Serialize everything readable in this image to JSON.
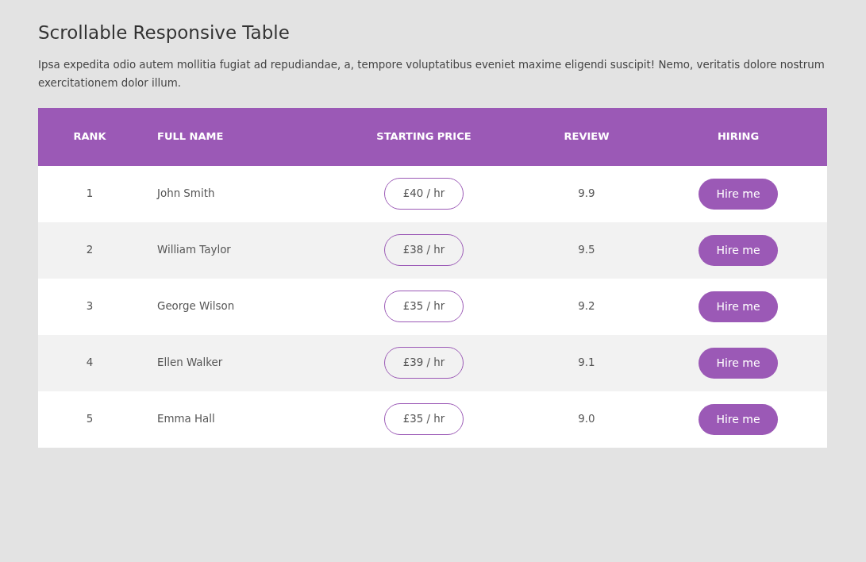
{
  "title": "Scrollable Responsive Table",
  "description": "Ipsa expedita odio autem mollitia fugiat ad repudiandae, a, tempore voluptatibus eveniet maxime eligendi suscipit! Nemo, veritatis dolore nostrum exercitationem dolor illum.",
  "table": {
    "columns": [
      "RANK",
      "FULL NAME",
      "STARTING PRICE",
      "REVIEW",
      "HIRING"
    ],
    "rows": [
      {
        "rank": "1",
        "name": "John Smith",
        "price": "£40 / hr",
        "review": "9.9",
        "action": "Hire me"
      },
      {
        "rank": "2",
        "name": "William Taylor",
        "price": "£38 / hr",
        "review": "9.5",
        "action": "Hire me"
      },
      {
        "rank": "3",
        "name": "George Wilson",
        "price": "£35 / hr",
        "review": "9.2",
        "action": "Hire me"
      },
      {
        "rank": "4",
        "name": "Ellen Walker",
        "price": "£39 / hr",
        "review": "9.1",
        "action": "Hire me"
      },
      {
        "rank": "5",
        "name": "Emma Hall",
        "price": "£35 / hr",
        "review": "9.0",
        "action": "Hire me"
      }
    ]
  }
}
